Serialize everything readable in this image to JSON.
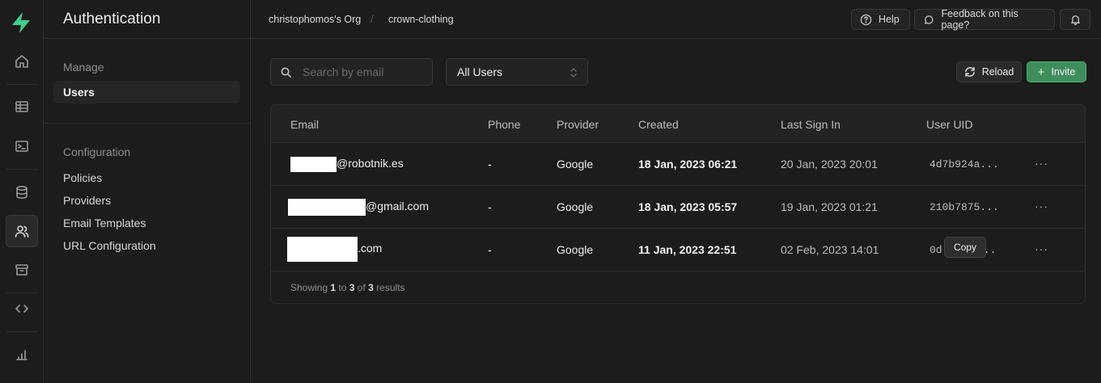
{
  "nav": {
    "icons": [
      "home-icon",
      "table-editor-icon",
      "sql-editor-icon",
      "database-icon",
      "authentication-icon",
      "storage-icon",
      "api-icon",
      "reports-icon"
    ],
    "active": "authentication-icon"
  },
  "sidebar": {
    "title": "Authentication",
    "manage_label": "Manage",
    "manage_items": [
      {
        "label": "Users"
      }
    ],
    "config_label": "Configuration",
    "config_items": [
      {
        "label": "Policies"
      },
      {
        "label": "Providers"
      },
      {
        "label": "Email Templates"
      },
      {
        "label": "URL Configuration"
      }
    ]
  },
  "header": {
    "org": "christophomos's Org",
    "separator": "/",
    "project": "crown-clothing",
    "help_label": "Help",
    "feedback_label": "Feedback on this page?"
  },
  "toolbar": {
    "search_placeholder": "Search by email",
    "filter_value": "All Users",
    "reload_label": "Reload",
    "invite_label": "Invite",
    "invite_icon": "+"
  },
  "table": {
    "columns": [
      "Email",
      "Phone",
      "Provider",
      "Created",
      "Last Sign In",
      "User UID"
    ],
    "rows": [
      {
        "email_visible": "@robotnik.es",
        "phone": "-",
        "provider": "Google",
        "created": "18 Jan, 2023 06:21",
        "last_sign_in": "20 Jan, 2023 20:01",
        "uid": "4d7b924a...",
        "menu": "···"
      },
      {
        "email_visible": "@gmail.com",
        "phone": "-",
        "provider": "Google",
        "created": "18 Jan, 2023 05:57",
        "last_sign_in": "19 Jan, 2023 01:21",
        "uid": "210b7875...",
        "menu": "···"
      },
      {
        "email_visible": ".com",
        "phone": "-",
        "provider": "Google",
        "created": "11 Jan, 2023 22:51",
        "last_sign_in": "02 Feb, 2023 14:01",
        "uid": "0d",
        "uid_tail": "...",
        "menu": "···"
      }
    ],
    "tooltip": "Copy",
    "footer": {
      "prefix": "Showing",
      "from": "1",
      "to_word": "to",
      "to": "3",
      "of_word": "of",
      "total": "3",
      "suffix": "results"
    }
  }
}
